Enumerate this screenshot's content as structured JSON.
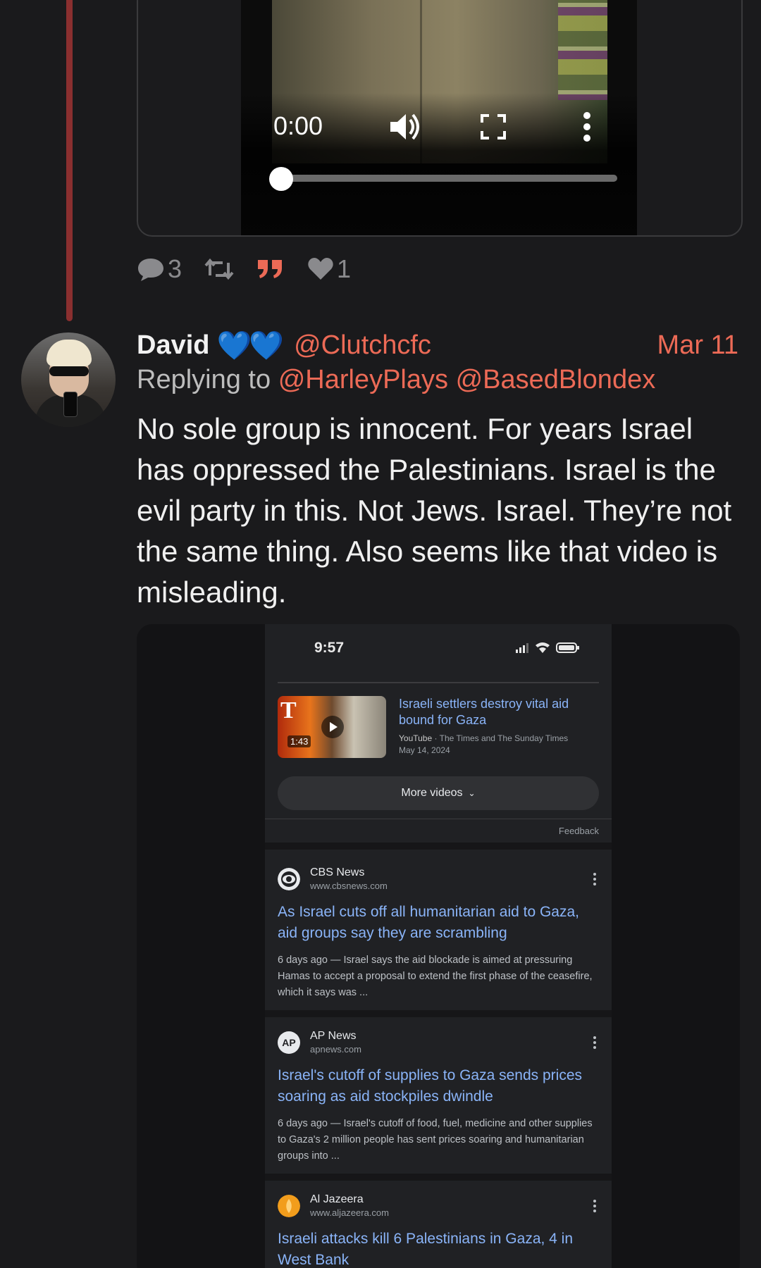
{
  "video": {
    "time": "0:00",
    "progress": 0
  },
  "actions": {
    "replies": "3",
    "likes": "1"
  },
  "tweet": {
    "name": "David",
    "badge_emoji": "💙💙",
    "handle": "@Clutchcfc",
    "date": "Mar 11",
    "replying_prefix": "Replying to",
    "mentions": [
      "@HarleyPlays",
      "@BasedBlondex"
    ],
    "text": "No sole group is innocent. For years Israel has oppressed the Palestinians. Israel is the evil party in this. Not Jews. Israel. They’re not the same thing. Also seems like that video is misleading."
  },
  "embed": {
    "status_time": "9:57",
    "video_result": {
      "thumb_letter": "T",
      "duration": "1:43",
      "title": "Israeli settlers destroy vital aid bound for Gaza",
      "source": "YouTube",
      "channel": "· The Times and The Sunday Times",
      "date": "May 14, 2024"
    },
    "more_videos": "More videos",
    "feedback": "Feedback",
    "results": [
      {
        "source": "CBS News",
        "url": "www.cbsnews.com",
        "title": "As Israel cuts off all humanitarian aid to Gaza, aid groups say they are scrambling",
        "snippet": "6 days ago — Israel says the aid blockade is aimed at pressuring Hamas to accept a proposal to extend the first phase of the ceasefire, which it says was ..."
      },
      {
        "source": "AP News",
        "url": "apnews.com",
        "logo_text": "AP",
        "title": "Israel's cutoff of supplies to Gaza sends prices soaring as aid stockpiles dwindle",
        "snippet": "6 days ago — Israel's cutoff of food, fuel, medicine and other supplies to Gaza's 2 million people has sent prices soaring and humanitarian groups into ..."
      },
      {
        "source": "Al Jazeera",
        "url": "www.aljazeera.com",
        "title": "Israeli attacks kill 6 Palestinians in Gaza, 4 in West Bank",
        "snippet": ""
      }
    ]
  },
  "colors": {
    "background": "#1a1a1c",
    "accent": "#ec6a56",
    "thread_line": "#8a2f2f",
    "link_blue": "#8ab4f8",
    "heart_blue": "#1da1f2"
  }
}
